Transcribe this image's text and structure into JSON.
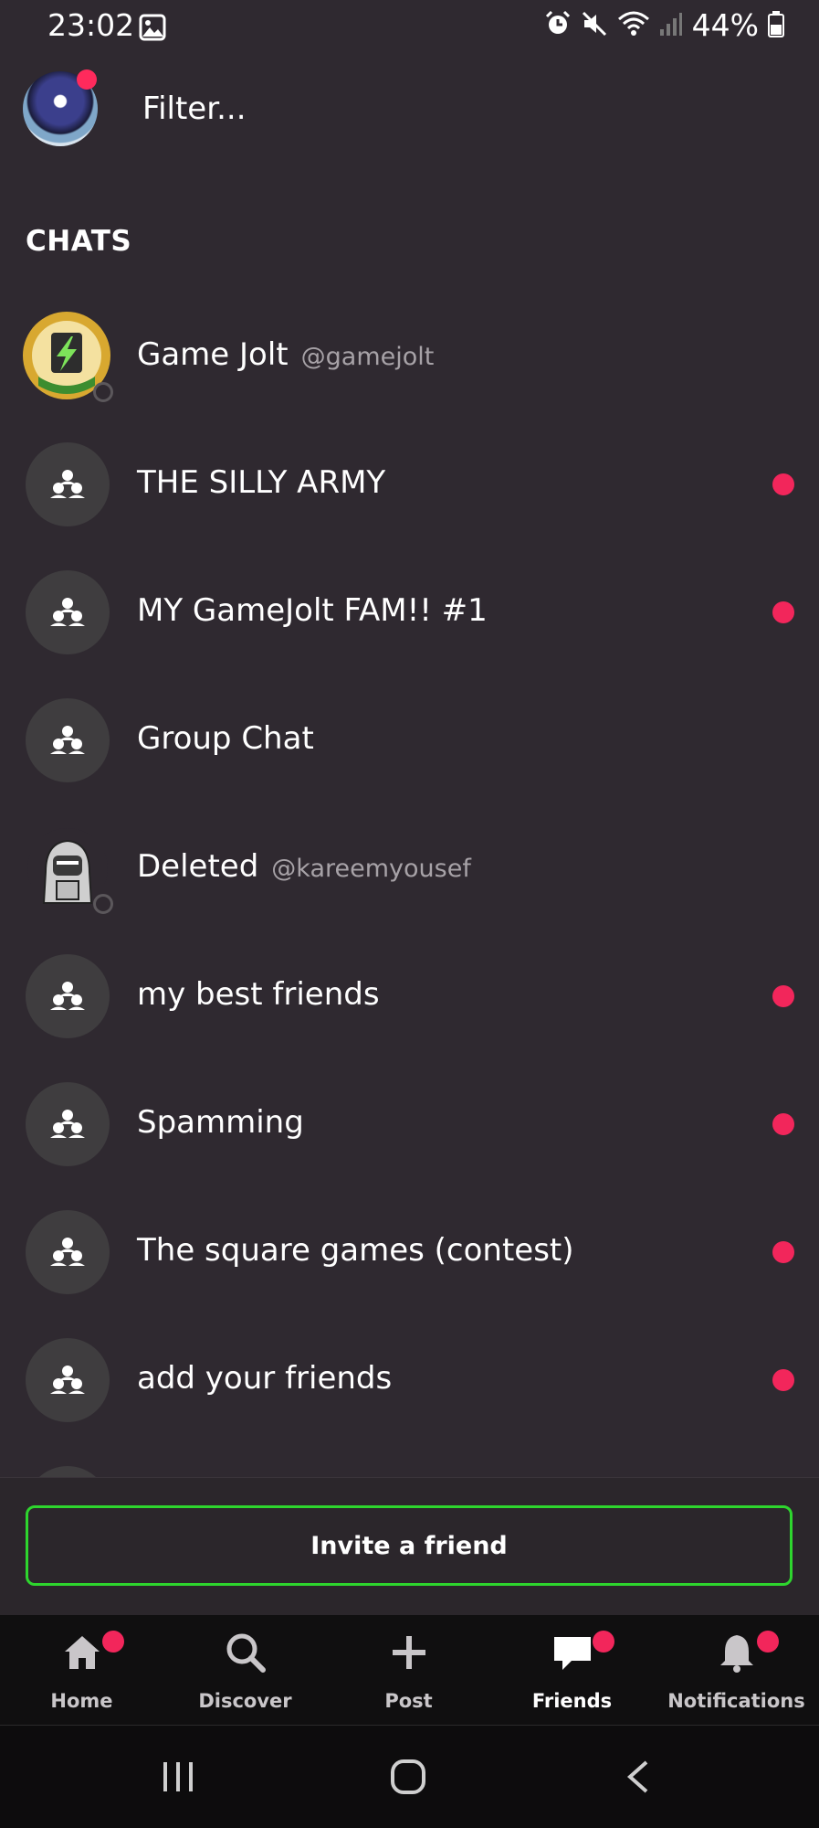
{
  "status_bar": {
    "time": "23:02",
    "battery": "44%",
    "icons": [
      "gallery-icon",
      "alarm-icon",
      "mute-icon",
      "wifi-icon",
      "signal-icon",
      "battery-icon"
    ]
  },
  "header": {
    "filter_placeholder": "Filter...",
    "avatar_has_notification": true
  },
  "section_title": "CHATS",
  "chats": [
    {
      "name": "Game Jolt",
      "handle": "@gamejolt",
      "type": "user",
      "unread": false
    },
    {
      "name": "THE SILLY ARMY",
      "handle": "",
      "type": "group",
      "unread": true
    },
    {
      "name": "MY GameJolt FAM!! #1",
      "handle": "",
      "type": "group",
      "unread": true
    },
    {
      "name": "Group Chat",
      "handle": "",
      "type": "group",
      "unread": false
    },
    {
      "name": "Deleted",
      "handle": "@kareemyousef",
      "type": "user",
      "unread": false
    },
    {
      "name": "my best friends",
      "handle": "",
      "type": "group",
      "unread": true
    },
    {
      "name": "Spamming",
      "handle": "",
      "type": "group",
      "unread": true
    },
    {
      "name": "The square games (contest)",
      "handle": "",
      "type": "group",
      "unread": true
    },
    {
      "name": "add your friends",
      "handle": "",
      "type": "group",
      "unread": true
    }
  ],
  "invite_button": "Invite a friend",
  "tabs": [
    {
      "label": "Home",
      "icon": "home-icon",
      "badge": true,
      "active": false
    },
    {
      "label": "Discover",
      "icon": "search-icon",
      "badge": false,
      "active": false
    },
    {
      "label": "Post",
      "icon": "plus-icon",
      "badge": false,
      "active": false
    },
    {
      "label": "Friends",
      "icon": "chat-bubble-icon",
      "badge": true,
      "active": true
    },
    {
      "label": "Notifications",
      "icon": "bell-icon",
      "badge": true,
      "active": false
    }
  ],
  "colors": {
    "background": "#2f2930",
    "accent_unread": "#f2265b",
    "invite_border": "#2ed52e",
    "tabbar": "#100f10"
  }
}
